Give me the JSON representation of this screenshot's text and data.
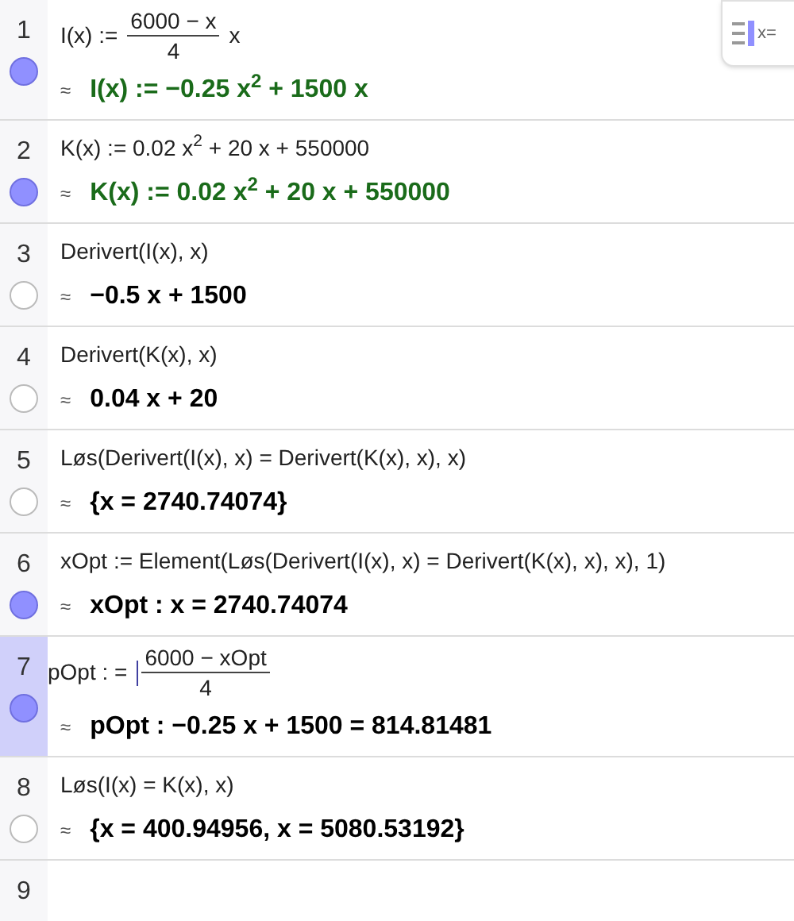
{
  "toggle_button": {
    "label": "x="
  },
  "rows": [
    {
      "number": "1",
      "visible": true,
      "selected": false,
      "kind": "definition",
      "input": [
        {
          "kind": "text",
          "text": "I(x) :="
        },
        {
          "kind": "fraction",
          "numerator": "6000 − x",
          "denominator": "4"
        },
        {
          "kind": "text",
          "text": "x"
        }
      ],
      "marker": "≈",
      "output": "I(x) := −0.25 x$^{2}$ + 1500 x"
    },
    {
      "number": "2",
      "visible": true,
      "selected": false,
      "kind": "definition",
      "input": [
        {
          "kind": "text",
          "text": "K(x) := 0.02 x$^{2}$ + 20 x + 550000"
        }
      ],
      "marker": "≈",
      "output": "K(x) := 0.02 x$^{2}$ + 20 x + 550000"
    },
    {
      "number": "3",
      "visible": false,
      "selected": false,
      "kind": "result",
      "input": [
        {
          "kind": "text",
          "text": "Derivert(I(x), x)"
        }
      ],
      "marker": "≈",
      "output": "−0.5 x + 1500"
    },
    {
      "number": "4",
      "visible": false,
      "selected": false,
      "kind": "result",
      "input": [
        {
          "kind": "text",
          "text": "Derivert(K(x), x)"
        }
      ],
      "marker": "≈",
      "output": "0.04 x + 20"
    },
    {
      "number": "5",
      "visible": false,
      "selected": false,
      "kind": "result",
      "input": [
        {
          "kind": "text",
          "text": "Løs(Derivert(I(x), x) = Derivert(K(x), x), x)"
        }
      ],
      "marker": "≈",
      "output": "{x = 2740.74074}"
    },
    {
      "number": "6",
      "visible": true,
      "selected": false,
      "kind": "result",
      "input": [
        {
          "kind": "text",
          "text": "xOpt := Element(Løs(Derivert(I(x), x) = Derivert(K(x), x), x), 1)"
        }
      ],
      "marker": "≈",
      "output": "xOpt : x = 2740.74074"
    },
    {
      "number": "7",
      "visible": true,
      "selected": true,
      "kind": "result",
      "input": [
        {
          "kind": "text",
          "text": "pOpt : ="
        },
        {
          "kind": "cursor"
        },
        {
          "kind": "fraction",
          "numerator": "6000 − xOpt",
          "denominator": "4"
        }
      ],
      "marker": "≈",
      "output": "pOpt : −0.25 x + 1500 = 814.81481"
    },
    {
      "number": "8",
      "visible": false,
      "selected": false,
      "kind": "result",
      "input": [
        {
          "kind": "text",
          "text": "Løs(I(x) = K(x), x)"
        }
      ],
      "marker": "≈",
      "output": "{x = 400.94956, x = 5080.53192}"
    },
    {
      "number": "9",
      "kind": "empty",
      "selected": false
    }
  ]
}
